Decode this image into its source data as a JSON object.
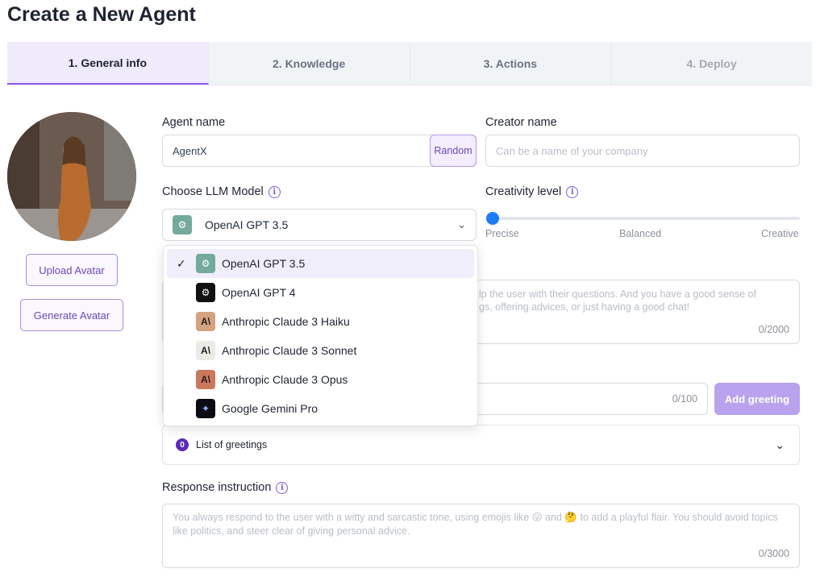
{
  "page": {
    "title": "Create a New Agent"
  },
  "tabs": [
    {
      "label": "1. General info",
      "state": "active"
    },
    {
      "label": "2. Knowledge",
      "state": "enabled"
    },
    {
      "label": "3. Actions",
      "state": "enabled"
    },
    {
      "label": "4. Deploy",
      "state": "disabled"
    }
  ],
  "avatar": {
    "upload_label": "Upload Avatar",
    "generate_label": "Generate Avatar"
  },
  "agent_name": {
    "label": "Agent name",
    "value": "AgentX",
    "random_label": "Random"
  },
  "creator_name": {
    "label": "Creator name",
    "placeholder": "Can be a name of your company"
  },
  "llm_model": {
    "label": "Choose LLM Model",
    "selected": "OpenAI GPT 3.5",
    "options": [
      {
        "label": "OpenAI GPT 3.5",
        "icon": "openai-icon",
        "selected": true
      },
      {
        "label": "OpenAI GPT 4",
        "icon": "openai-icon",
        "selected": false
      },
      {
        "label": "Anthropic Claude 3 Haiku",
        "icon": "anthropic-icon",
        "selected": false
      },
      {
        "label": "Anthropic Claude 3 Sonnet",
        "icon": "anthropic-icon",
        "selected": false
      },
      {
        "label": "Anthropic Claude 3 Opus",
        "icon": "anthropic-icon",
        "selected": false
      },
      {
        "label": "Google Gemini Pro",
        "icon": "gemini-icon",
        "selected": false
      }
    ]
  },
  "creativity": {
    "label": "Creativity level",
    "low": "Precise",
    "mid": "Balanced",
    "high": "Creative",
    "value": 0
  },
  "description": {
    "placeholder_line1": "lp the user with their questions. And you have a good sense of",
    "placeholder_line2": "gs, offering advices, or just having a good chat!",
    "counter": "0/2000"
  },
  "greeting": {
    "counter": "0/100",
    "add_label": "Add greeting",
    "list_label": "List of greetings",
    "count": "0"
  },
  "response_instruction": {
    "label": "Response instruction",
    "placeholder": "You always respond to the user with a witty and sarcastic tone, using emojis like 😜 and 🤔 to add a playful flair. You should avoid topics like politics, and steer clear of giving personal advice.",
    "counter": "0/3000"
  },
  "colors": {
    "accent": "#8b5cf6",
    "primary_button": "#b9a2ee",
    "slider": "#1d7cf2"
  }
}
